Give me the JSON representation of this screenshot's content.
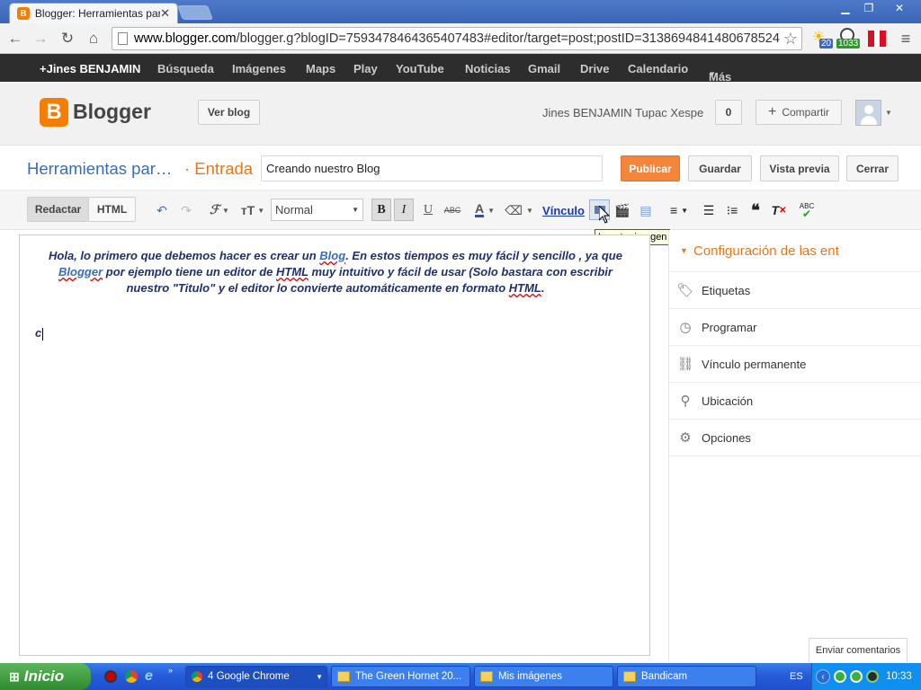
{
  "browser": {
    "tabs": [
      {
        "label": "Blogger: Herramientas para r",
        "favicon": "B"
      }
    ],
    "url_prefix": "www.blogger.com",
    "url_rest": "/blogger.g?blogID=7593478464365407483#editor/target=post;postID=3138694841480678524",
    "ext_badges": [
      "20",
      "1033"
    ]
  },
  "gbar": {
    "items": [
      "+Jines BENJAMIN",
      "Búsqueda",
      "Imágenes",
      "Maps",
      "Play",
      "YouTube",
      "Noticias",
      "Gmail",
      "Drive",
      "Calendario",
      "Más"
    ]
  },
  "header": {
    "logo_letter": "B",
    "logo_text": "Blogger",
    "view_blog": "Ver blog",
    "user_name": "Jines BENJAMIN Tupac Xespe",
    "notif_count": "0",
    "share_label": "Compartir"
  },
  "post": {
    "blog_name": "Herramientas par…",
    "section": "· Entrada",
    "title_value": "Creando nuestro Blog",
    "buttons": {
      "publish": "Publicar",
      "save": "Guardar",
      "preview": "Vista previa",
      "close": "Cerrar"
    }
  },
  "editor_toolbar": {
    "mode_compose": "Redactar",
    "mode_html": "HTML",
    "format_value": "Normal",
    "link_label": "Vínculo",
    "tooltip": "Insertar imagen"
  },
  "content": {
    "p1": "Hola, lo primero que debemos hacer es crear un ",
    "link_blog": "Blog",
    "p2": ". En estos tiempos es muy fácil y sencillo , ya que ",
    "link_blogger": "Blogger",
    "p3": " por ejemplo tiene un editor de ",
    "html1": "HTML",
    "p4": " muy intuitivo y fácil de usar (Solo bastara con escribir nuestro \"Titulo\" y el editor lo convierte automáticamente en formato ",
    "html2": "HTML",
    "p5": ".",
    "typed": "c"
  },
  "side_panel": {
    "title": "Configuración de las ent",
    "items": [
      "Etiquetas",
      "Programar",
      "Vínculo permanente",
      "Ubicación",
      "Opciones"
    ]
  },
  "feedback": "Enviar comentarios",
  "taskbar": {
    "start": "Inicio",
    "tasks": [
      "4 Google Chrome",
      "The Green Hornet 20...",
      "Mis imágenes",
      "Bandicam"
    ],
    "lang": "ES",
    "clock": "10:33"
  }
}
